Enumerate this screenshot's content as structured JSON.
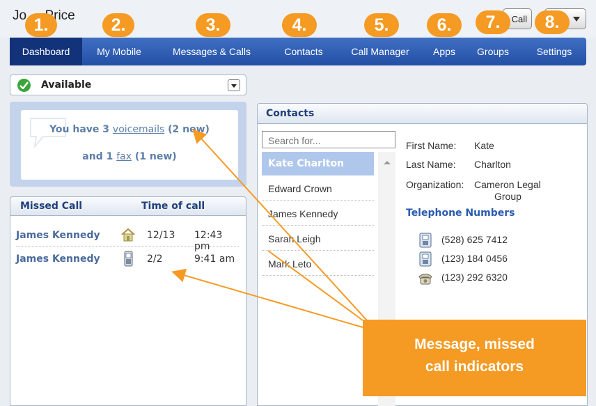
{
  "title_bar": {
    "user_name": "Jo     Price",
    "call_button_label": "Call"
  },
  "nav": {
    "tabs": [
      {
        "label": "Dashboard",
        "active": true
      },
      {
        "label": "My Mobile"
      },
      {
        "label": "Messages & Calls"
      },
      {
        "label": "Contacts"
      },
      {
        "label": "Call Manager"
      },
      {
        "label": "Apps"
      },
      {
        "label": "Groups"
      },
      {
        "label": "Settings"
      }
    ]
  },
  "badges": [
    "1.",
    "2.",
    "3.",
    "4.",
    "5.",
    "6.",
    "7.",
    "8."
  ],
  "status": {
    "label": "Available"
  },
  "voicemail": {
    "text_a": "You have 3 ",
    "link_a": "voicemails",
    "text_b": " (2 new)",
    "text_c": "and 1 ",
    "link_b": "fax",
    "text_d": " (1 new)"
  },
  "missed_calls": {
    "header_name": "Missed Call",
    "header_time": "Time of call",
    "rows": [
      {
        "name": "James Kennedy",
        "icon": "home-phone-icon",
        "date": "12/13",
        "time": "12:43 pm"
      },
      {
        "name": "James Kennedy",
        "icon": "mobile-phone-icon",
        "date": "2/2",
        "time": "9:41 am"
      }
    ]
  },
  "contacts": {
    "header": "Contacts",
    "search_placeholder": "Search for...",
    "list": [
      "Kate Charlton",
      "Edward Crown",
      "James Kennedy",
      "Sarah Leigh",
      "Mark Leto"
    ],
    "selected_index": 0,
    "details": {
      "first_name_label": "First Name:",
      "first_name": "Kate",
      "last_name_label": "Last Name:",
      "last_name": "Charlton",
      "org_label": "Organization:",
      "org_line1": "Cameron Legal",
      "org_line2": "Group",
      "telephone_title": "Telephone Numbers",
      "phones": [
        {
          "icon": "mobile-phone-icon",
          "number": "(528) 625 7412"
        },
        {
          "icon": "mobile-phone-icon",
          "number": "(123) 184 0456"
        },
        {
          "icon": "desk-phone-icon",
          "number": "(123) 292 6320"
        }
      ]
    }
  },
  "callout": {
    "line1": "Message, missed",
    "line2": "call indicators"
  },
  "colors": {
    "badge": "#f59a23",
    "nav": "#2350a6",
    "nav_active": "#12327a",
    "selected_contact": "#b0c7ec",
    "link_blue": "#2a5bb0"
  }
}
